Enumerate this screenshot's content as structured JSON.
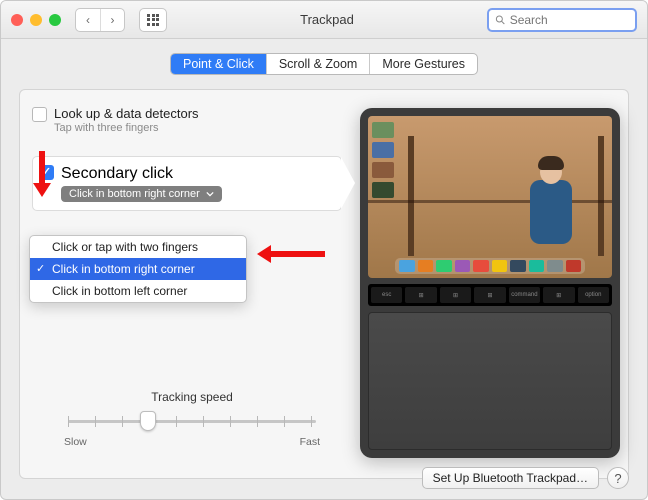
{
  "window": {
    "title": "Trackpad"
  },
  "search": {
    "placeholder": "Search",
    "value": ""
  },
  "tabs": [
    {
      "label": "Point & Click",
      "active": true
    },
    {
      "label": "Scroll & Zoom",
      "active": false
    },
    {
      "label": "More Gestures",
      "active": false
    }
  ],
  "options": {
    "lookup": {
      "title": "Look up & data detectors",
      "subtitle": "Tap with three fingers",
      "checked": false
    },
    "secondary": {
      "title": "Secondary click",
      "selected_label": "Click in bottom right corner",
      "checked": true
    }
  },
  "dropdown": {
    "items": [
      {
        "label": "Click or tap with two fingers",
        "selected": false
      },
      {
        "label": "Click in bottom right corner",
        "selected": true
      },
      {
        "label": "Click in bottom left corner",
        "selected": false
      }
    ]
  },
  "tracking": {
    "label": "Tracking speed",
    "slow": "Slow",
    "fast": "Fast",
    "value": 3,
    "steps": 10
  },
  "footer": {
    "setup_label": "Set Up Bluetooth Trackpad…",
    "help": "?"
  },
  "colors": {
    "accent": "#2f7cf6",
    "arrow": "#e11"
  }
}
